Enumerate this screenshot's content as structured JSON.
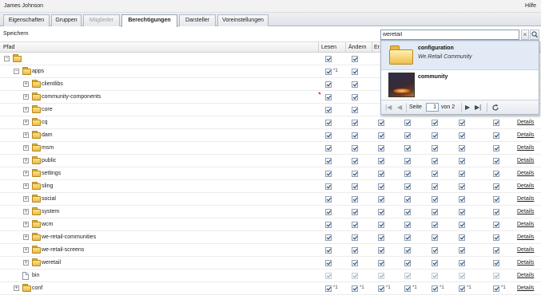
{
  "topbar": {
    "user": "James Johnson",
    "help": "Hilfe"
  },
  "tabs": [
    {
      "label": "Eigenschaften",
      "state": "normal"
    },
    {
      "label": "Gruppen",
      "state": "normal"
    },
    {
      "label": "Mitglieder",
      "state": "disabled"
    },
    {
      "label": "Berechtigungen",
      "state": "active"
    },
    {
      "label": "Darsteller",
      "state": "normal"
    },
    {
      "label": "Voreinstellungen",
      "state": "normal"
    }
  ],
  "toolbar": {
    "save_label": "Speichern"
  },
  "search": {
    "value": "weretail",
    "clear_symbol": "×"
  },
  "columns": {
    "path": "Pfad",
    "read": "Lesen",
    "modify": "Ändern",
    "create_partial": "Er"
  },
  "rows": [
    {
      "label": "",
      "level": 0,
      "expander": "−",
      "icon": "folder-icon",
      "checks": [
        true,
        true
      ],
      "mark": [
        false,
        false
      ],
      "details": ""
    },
    {
      "label": "apps",
      "level": 1,
      "expander": "−",
      "icon": "folder-icon",
      "checks": [
        true,
        true
      ],
      "mark": [
        true,
        false
      ],
      "details": ""
    },
    {
      "label": "clientlibs",
      "level": 2,
      "expander": "+",
      "icon": "folder-icon",
      "checks": [
        true,
        true
      ],
      "mark": [
        false,
        false
      ],
      "details": ""
    },
    {
      "label": "community-components",
      "level": 2,
      "expander": "+",
      "icon": "folder-icon",
      "checks": [
        true,
        true
      ],
      "mark": [
        false,
        false
      ],
      "details": "",
      "flag": true
    },
    {
      "label": "core",
      "level": 2,
      "expander": "+",
      "icon": "folder-icon",
      "checks": [
        true,
        true
      ],
      "mark": [
        false,
        false
      ],
      "details": ""
    },
    {
      "label": "cq",
      "level": 2,
      "expander": "+",
      "icon": "folder-icon",
      "checks": [
        true,
        true,
        true,
        true,
        true,
        true,
        true
      ],
      "mark": [
        false,
        false,
        false,
        false,
        false,
        false,
        false
      ],
      "details": "Details"
    },
    {
      "label": "dam",
      "level": 2,
      "expander": "+",
      "icon": "folder-icon",
      "checks": [
        true,
        true,
        true,
        true,
        true,
        true,
        true
      ],
      "mark": [
        false,
        false,
        false,
        false,
        false,
        false,
        false
      ],
      "details": "Details"
    },
    {
      "label": "msm",
      "level": 2,
      "expander": "+",
      "icon": "folder-icon",
      "checks": [
        true,
        true,
        true,
        true,
        true,
        true,
        true
      ],
      "mark": [
        false,
        false,
        false,
        false,
        false,
        false,
        false
      ],
      "details": "Details"
    },
    {
      "label": "public",
      "level": 2,
      "expander": "+",
      "icon": "folder-icon",
      "checks": [
        true,
        true,
        true,
        true,
        true,
        true,
        true
      ],
      "mark": [
        false,
        false,
        false,
        false,
        false,
        false,
        false
      ],
      "details": "Details"
    },
    {
      "label": "settings",
      "level": 2,
      "expander": "+",
      "icon": "folder-icon",
      "checks": [
        true,
        true,
        true,
        true,
        true,
        true,
        true
      ],
      "mark": [
        false,
        false,
        false,
        false,
        false,
        false,
        false
      ],
      "details": "Details"
    },
    {
      "label": "sling",
      "level": 2,
      "expander": "+",
      "icon": "folder-icon",
      "checks": [
        true,
        true,
        true,
        true,
        true,
        true,
        true
      ],
      "mark": [
        false,
        false,
        false,
        false,
        false,
        false,
        false
      ],
      "details": "Details"
    },
    {
      "label": "social",
      "level": 2,
      "expander": "+",
      "icon": "folder-icon",
      "checks": [
        true,
        true,
        true,
        true,
        true,
        true,
        true
      ],
      "mark": [
        false,
        false,
        false,
        false,
        false,
        false,
        false
      ],
      "details": "Details"
    },
    {
      "label": "system",
      "level": 2,
      "expander": "+",
      "icon": "folder-icon",
      "checks": [
        true,
        true,
        true,
        true,
        true,
        true,
        true
      ],
      "mark": [
        false,
        false,
        false,
        false,
        false,
        false,
        false
      ],
      "details": "Details"
    },
    {
      "label": "wcm",
      "level": 2,
      "expander": "+",
      "icon": "folder-icon",
      "checks": [
        true,
        true,
        true,
        true,
        true,
        true,
        true
      ],
      "mark": [
        false,
        false,
        false,
        false,
        false,
        false,
        false
      ],
      "details": "Details"
    },
    {
      "label": "we-retail-communities",
      "level": 2,
      "expander": "+",
      "icon": "folder-icon",
      "checks": [
        true,
        true,
        true,
        true,
        true,
        true,
        true
      ],
      "mark": [
        false,
        false,
        false,
        false,
        false,
        false,
        false
      ],
      "details": "Details"
    },
    {
      "label": "we-retail-screens",
      "level": 2,
      "expander": "+",
      "icon": "folder-icon",
      "checks": [
        true,
        true,
        true,
        true,
        true,
        true,
        true
      ],
      "mark": [
        false,
        false,
        false,
        false,
        false,
        false,
        false
      ],
      "details": "Details"
    },
    {
      "label": "weretail",
      "level": 2,
      "expander": "+",
      "icon": "folder-icon",
      "checks": [
        true,
        true,
        true,
        true,
        true,
        true,
        true
      ],
      "mark": [
        false,
        false,
        false,
        false,
        false,
        false,
        false
      ],
      "details": "Details"
    },
    {
      "label": "bin",
      "level": 1,
      "expander": "",
      "icon": "file-icon",
      "checks": [
        true,
        true,
        true,
        true,
        true,
        true,
        true
      ],
      "disabled": true,
      "mark": [
        false,
        false,
        false,
        false,
        false,
        false,
        false
      ],
      "details": "Details"
    },
    {
      "label": "conf",
      "level": 1,
      "expander": "+",
      "icon": "folder-icon",
      "checks": [
        true,
        true,
        true,
        true,
        true,
        true,
        true
      ],
      "mark": [
        true,
        true,
        true,
        true,
        true,
        true,
        true
      ],
      "details": "Details"
    }
  ],
  "mark_text": "*1",
  "results": [
    {
      "title": "configuration",
      "subtitle": "We.Retail Community",
      "thumb": "folder-icon",
      "selected": true
    },
    {
      "title": "community",
      "subtitle": "",
      "thumb": "photo-thumbnail",
      "selected": false
    }
  ],
  "pager": {
    "page_label": "Seite",
    "page_value": "1",
    "of_label": "von 2"
  }
}
